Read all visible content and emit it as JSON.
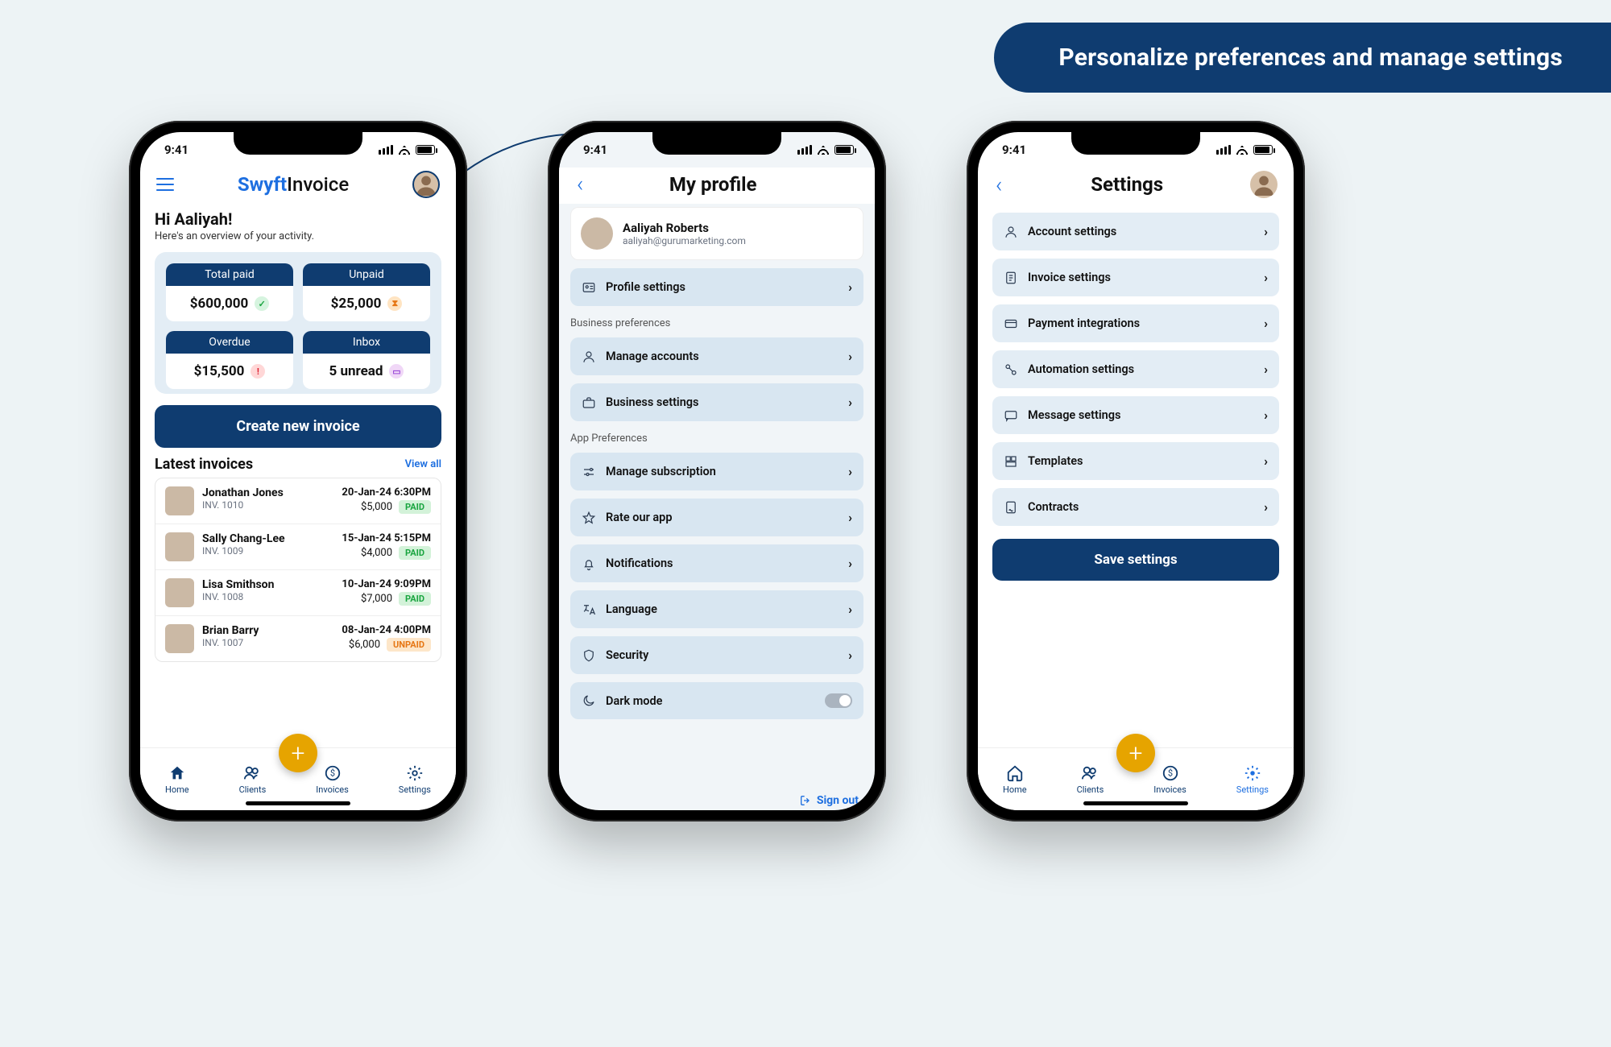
{
  "banner": "Personalize preferences and manage settings",
  "status_time": "9:41",
  "brand": {
    "part1": "Swyft",
    "part2": "Invoice"
  },
  "home": {
    "greeting_title": "Hi Aaliyah!",
    "greeting_sub": "Here's an overview of your activity.",
    "cards": [
      {
        "label": "Total paid",
        "value": "$600,000",
        "badge": "green"
      },
      {
        "label": "Unpaid",
        "value": "$25,000",
        "badge": "amber"
      },
      {
        "label": "Overdue",
        "value": "$15,500",
        "badge": "red"
      },
      {
        "label": "Inbox",
        "value": "5 unread",
        "badge": "purp"
      }
    ],
    "cta": "Create new invoice",
    "latest_title": "Latest invoices",
    "view_all": "View all",
    "invoices": [
      {
        "name": "Jonathan Jones",
        "num": "INV. 1010",
        "date": "20-Jan-24 6:30PM",
        "amount": "$5,000",
        "status": "PAID"
      },
      {
        "name": "Sally Chang-Lee",
        "num": "INV. 1009",
        "date": "15-Jan-24 5:15PM",
        "amount": "$4,000",
        "status": "PAID"
      },
      {
        "name": "Lisa Smithson",
        "num": "INV. 1008",
        "date": "10-Jan-24 9:09PM",
        "amount": "$7,000",
        "status": "PAID"
      },
      {
        "name": "Brian Barry",
        "num": "INV. 1007",
        "date": "08-Jan-24 4:00PM",
        "amount": "$6,000",
        "status": "UNPAID"
      }
    ]
  },
  "profile": {
    "title": "My profile",
    "user_name": "Aaliyah Roberts",
    "user_email": "aaliyah@gurumarketing.com",
    "profile_settings": "Profile settings",
    "section_business": "Business preferences",
    "business_rows": [
      "Manage accounts",
      "Business settings"
    ],
    "section_app": "App Preferences",
    "app_rows": [
      "Manage subscription",
      "Rate our app",
      "Notifications",
      "Language",
      "Security",
      "Dark mode"
    ],
    "sign_out": "Sign out"
  },
  "settings": {
    "title": "Settings",
    "rows": [
      "Account settings",
      "Invoice settings",
      "Payment integrations",
      "Automation settings",
      "Message settings",
      "Templates",
      "Contracts"
    ],
    "save": "Save settings"
  },
  "tabs": {
    "home": "Home",
    "clients": "Clients",
    "invoices": "Invoices",
    "settings": "Settings"
  }
}
